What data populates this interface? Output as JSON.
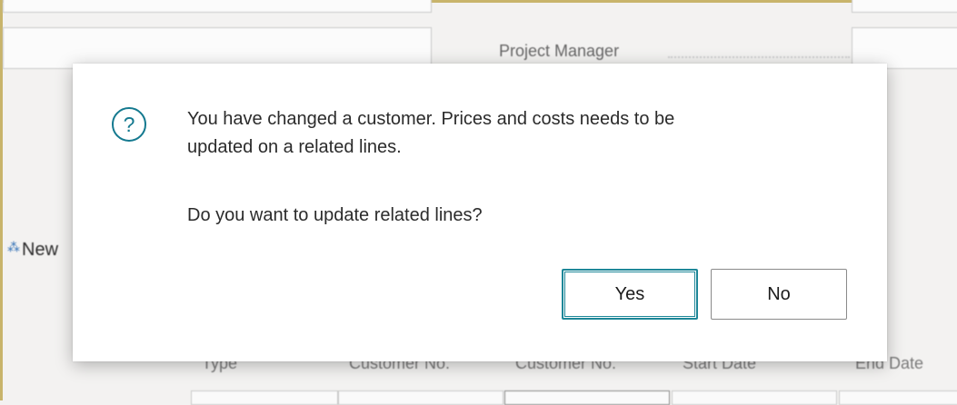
{
  "background": {
    "project_manager_label": "Project Manager",
    "new_action_label": "New",
    "columns": [
      "Type",
      "Customer No.",
      "Customer No.",
      "Start Date",
      "End Date"
    ]
  },
  "dialog": {
    "line1": "You have changed a customer. Prices and costs needs to be",
    "line2": "updated on a related lines.",
    "question": "Do you want to update related lines?",
    "icon": "question-circle-icon",
    "icon_glyph": "?",
    "yes_label": "Yes",
    "no_label": "No",
    "accent_color": "#14798f"
  }
}
